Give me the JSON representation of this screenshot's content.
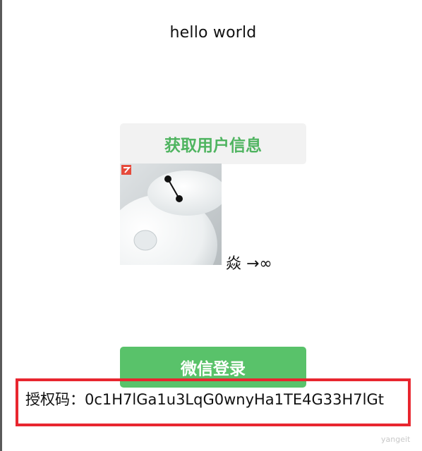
{
  "title": "hello world",
  "buttons": {
    "get_user_info_label": "获取用户信息",
    "wechat_login_label": "微信登录"
  },
  "user": {
    "nickname": "焱 →∞"
  },
  "auth": {
    "text": "授权码：0c1H7lGa1u3LqG0wnyHa1TE4G33H7lGt"
  },
  "watermark": "yangeit",
  "colors": {
    "accent_green": "#59c26a",
    "label_green": "#4fb460",
    "highlight_red": "#e8262f",
    "secondary_button_bg": "#f2f2f2"
  },
  "icons": {
    "avatar": "robot-avatar-image"
  }
}
